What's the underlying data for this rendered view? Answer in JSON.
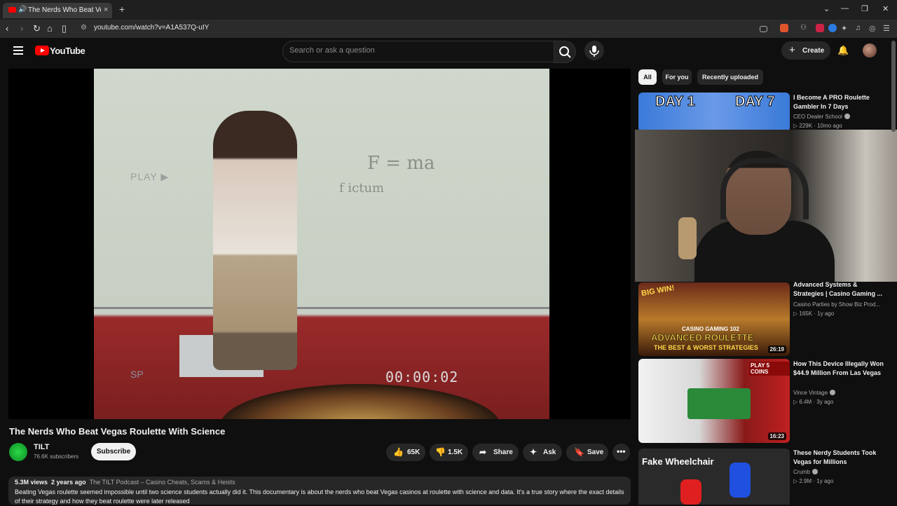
{
  "browser": {
    "tab_title": "The Nerds Who Beat Vegas Ro",
    "url": "youtube.com/watch?v=A1A537Q-uIY",
    "new_tab_symbol": "+",
    "tab_close_symbol": "×"
  },
  "header": {
    "logo": "YouTube",
    "search_placeholder": "Search or ask a question",
    "create_label": "Create"
  },
  "player": {
    "overlay_play": "PLAY ▶",
    "overlay_sp": "SP",
    "timecode": "00:00:02",
    "board_eq1": "F = ma",
    "board_eq2": "f ictum"
  },
  "video": {
    "title": "The Nerds Who Beat Vegas Roulette With Science",
    "channel": "TILT",
    "subscribers": "76.6K subscribers",
    "subscribe_label": "Subscribe",
    "likes": "65K",
    "dislikes": "1.5K",
    "share_label": "Share",
    "ask_label": "Ask",
    "save_label": "Save",
    "views": "5.3M views",
    "age": "2 years ago",
    "playlist_tag": "The TILT Podcast – Casino Cheats, Scams & Heists",
    "description": "Beating Vegas roulette seemed impossible until two science students actually did it. This documentary is about the nerds who beat Vegas casinos at roulette with science and data. It's a true story where the exact details of their strategy and how they beat roulette were later released"
  },
  "chips": [
    "All",
    "For you",
    "Recently uploaded"
  ],
  "recommendations": [
    {
      "title": "I Become A PRO Roulette Gambler In 7 Days",
      "channel": "CEO Dealer School",
      "meta": "▷ 229K · 10mo ago",
      "thumb_text_left": "DAY 1",
      "thumb_text_right": "DAY 7"
    },
    {
      "title": "Advanced Systems & Strategies | Casino Gaming ...",
      "channel": "Casino Parties by Show Biz Prod...",
      "meta": "▷ 165K · 1y ago",
      "duration": "26:19",
      "thumb_text": "ADVANCED ROULETTE",
      "thumb_sub": "THE BEST & WORST STRATEGIES",
      "thumb_badge": "CASINO GAMING 102",
      "thumb_corner": "BIG WIN!"
    },
    {
      "title": "How This Device Illegally Won $44.9 Million From Las Vegas",
      "channel": "Vince Vintage",
      "meta": "▷ 6.4M · 3y ago",
      "duration": "16:23",
      "thumb_corner": "PLAY 5 COINS"
    },
    {
      "title": "These Nerdy Students Took Vegas for Millions",
      "channel": "Crumb",
      "meta": "▷ 2.9M · 1y ago",
      "thumb_text": "Fake Wheelchair"
    }
  ],
  "colors": {
    "bg": "#0f0f0f",
    "accent_red": "#ff0000",
    "chip_active": "#f1f1f1"
  }
}
